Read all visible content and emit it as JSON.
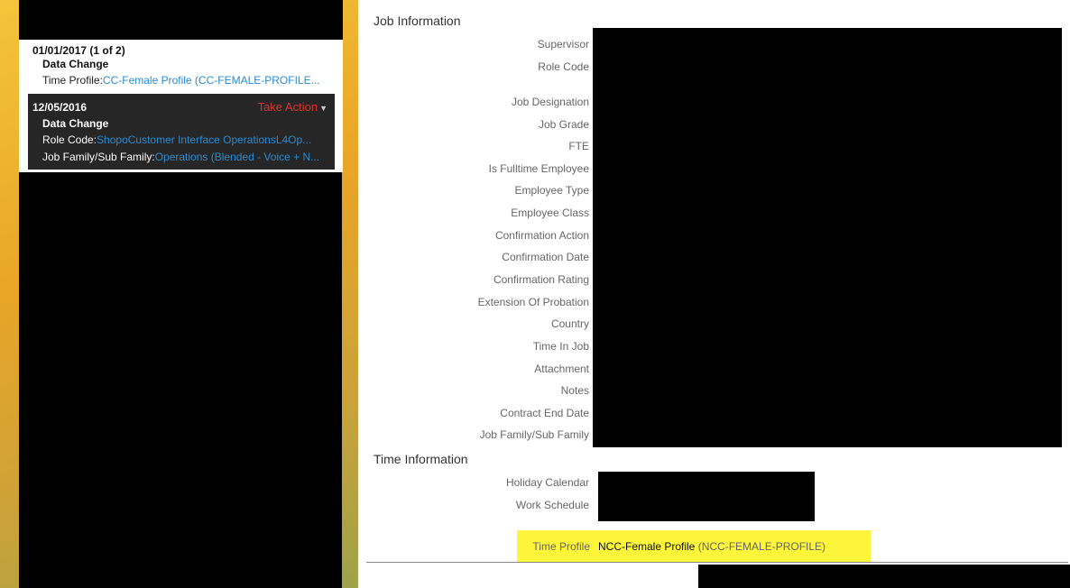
{
  "history": {
    "entry1": {
      "date": "01/01/2017 (1 of 2)",
      "type": "Data Change",
      "field_label": "Time Profile:",
      "field_value": "CC-Female Profile (CC-FEMALE-PROFILE..."
    },
    "entry2": {
      "date": "12/05/2016",
      "action": "Take Action",
      "type": "Data Change",
      "rows": [
        {
          "label": "Role Code:",
          "value": "ShopoCustomer Interface OperationsL4Op..."
        },
        {
          "label": "Job Family/Sub Family:",
          "value": "Operations (Blended - Voice + N..."
        }
      ]
    }
  },
  "job_information": {
    "title": "Job Information",
    "labels": {
      "supervisor": "Supervisor",
      "role_code": "Role Code",
      "job_designation": "Job Designation",
      "job_grade": "Job Grade",
      "fte": "FTE",
      "is_fulltime": "Is Fulltime Employee",
      "employee_type": "Employee Type",
      "employee_class": "Employee Class",
      "confirmation_action": "Confirmation Action",
      "confirmation_date": "Confirmation Date",
      "confirmation_rating": "Confirmation Rating",
      "extension_of_probation": "Extension Of Probation",
      "country": "Country",
      "time_in_job": "Time In Job",
      "attachment": "Attachment",
      "notes": "Notes",
      "contract_end_date": "Contract End Date",
      "job_family": "Job Family/Sub Family"
    }
  },
  "time_information": {
    "title": "Time Information",
    "holiday_calendar_label": "Holiday Calendar",
    "work_schedule_label": "Work Schedule",
    "time_profile_label": "Time Profile",
    "time_profile_value": "NCC-Female Profile",
    "time_profile_code": "(NCC-FEMALE-PROFILE)",
    "highlight_color": "#fcf53a"
  }
}
